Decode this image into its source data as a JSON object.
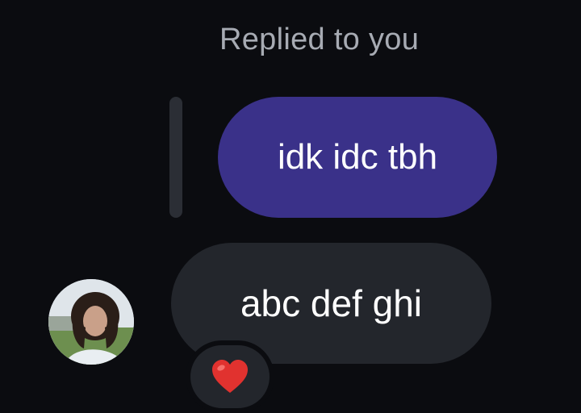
{
  "thread": {
    "reply_caption": "Replied to you",
    "quoted_message": "idk idc tbh",
    "message": "abc def ghi",
    "reaction": "heart-icon"
  },
  "colors": {
    "background": "#0b0c10",
    "quoted_bubble": "#3a3189",
    "message_bubble": "#23262c",
    "reaction": "#e1322f"
  }
}
